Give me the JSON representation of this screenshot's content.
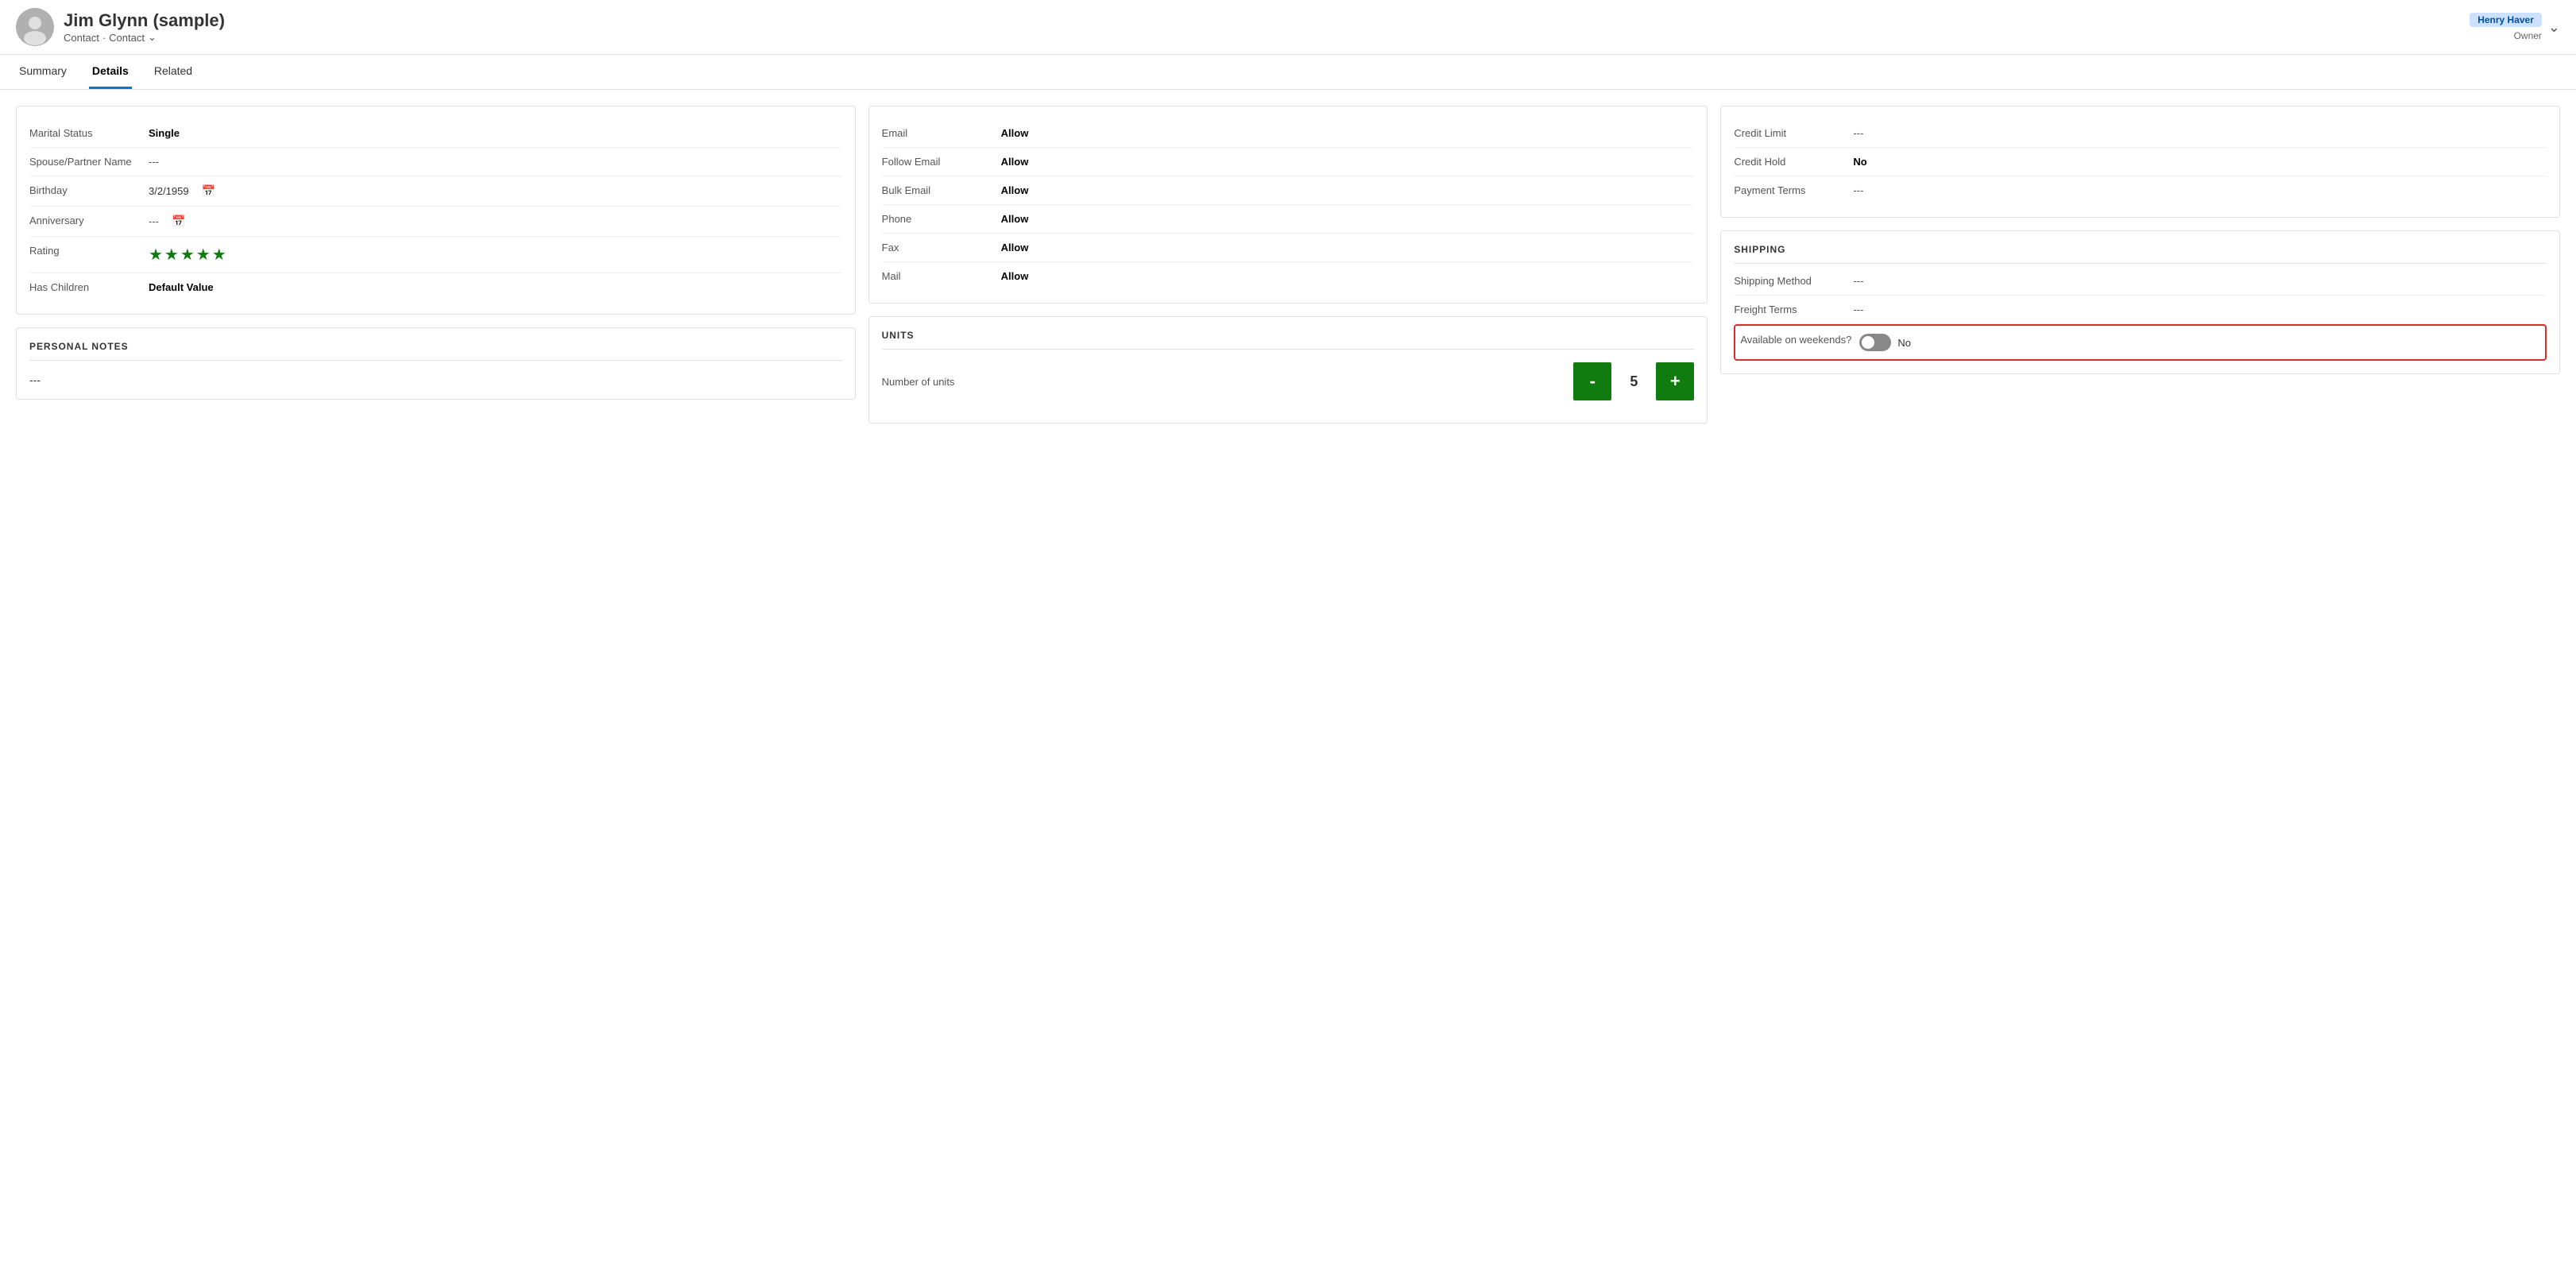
{
  "header": {
    "name": "Jim Glynn (sample)",
    "type1": "Contact",
    "type2": "Contact",
    "owner_badge": "Henry Haver",
    "owner_label": "Owner"
  },
  "tabs": [
    {
      "label": "Summary",
      "active": false
    },
    {
      "label": "Details",
      "active": true
    },
    {
      "label": "Related",
      "active": false
    }
  ],
  "personal_info": {
    "title": "",
    "fields": [
      {
        "label": "Marital Status",
        "value": "Single",
        "bold": true
      },
      {
        "label": "Spouse/Partner Name",
        "value": "---",
        "bold": false
      },
      {
        "label": "Birthday",
        "value": "3/2/1959",
        "bold": false,
        "calendar": true
      },
      {
        "label": "Anniversary",
        "value": "---",
        "bold": false,
        "calendar": true
      },
      {
        "label": "Rating",
        "value": "★★★★★",
        "stars": true
      },
      {
        "label": "Has Children",
        "value": "Default Value",
        "bold": true
      }
    ]
  },
  "personal_notes": {
    "title": "PERSONAL NOTES",
    "value": "---"
  },
  "contact_preferences": {
    "fields": [
      {
        "label": "Email",
        "value": "Allow",
        "bold": true
      },
      {
        "label": "Follow Email",
        "value": "Allow",
        "bold": true
      },
      {
        "label": "Bulk Email",
        "value": "Allow",
        "bold": true
      },
      {
        "label": "Phone",
        "value": "Allow",
        "bold": true
      },
      {
        "label": "Fax",
        "value": "Allow",
        "bold": true
      },
      {
        "label": "Mail",
        "value": "Allow",
        "bold": true
      }
    ]
  },
  "units": {
    "title": "Units",
    "number_of_units_label": "Number of units",
    "value": 5,
    "minus_label": "-",
    "plus_label": "+"
  },
  "billing": {
    "fields": [
      {
        "label": "Credit Limit",
        "value": "---"
      },
      {
        "label": "Credit Hold",
        "value": "No",
        "bold": true
      },
      {
        "label": "Payment Terms",
        "value": "---"
      }
    ]
  },
  "shipping": {
    "title": "SHIPPING",
    "fields": [
      {
        "label": "Shipping Method",
        "value": "---"
      },
      {
        "label": "Freight Terms",
        "value": "---"
      }
    ],
    "weekend_label": "Available on weekends?",
    "weekend_value": "No",
    "weekend_toggle": false
  },
  "icons": {
    "calendar": "📅",
    "chevron_down": "⌄"
  }
}
